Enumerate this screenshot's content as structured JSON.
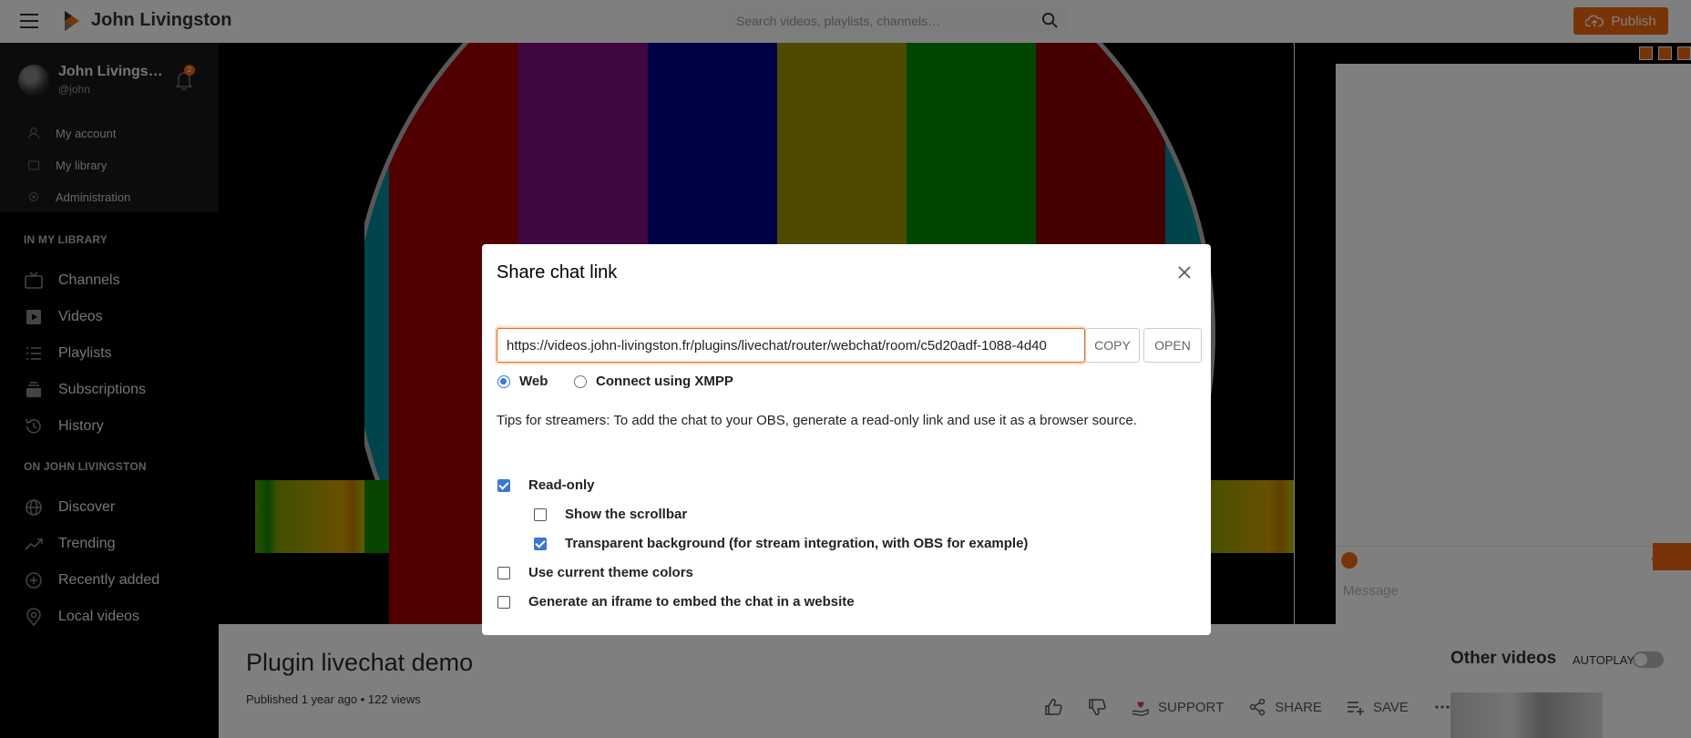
{
  "header": {
    "brand": "John Livingston",
    "search_placeholder": "Search videos, playlists, channels…",
    "publish_label": "Publish"
  },
  "sidebar": {
    "user": {
      "name": "John Livings…",
      "handle": "@john",
      "notifications": "2"
    },
    "user_links": [
      "My account",
      "My library",
      "Administration"
    ],
    "library_title": "IN MY LIBRARY",
    "library_items": [
      "Channels",
      "Videos",
      "Playlists",
      "Subscriptions",
      "History"
    ],
    "instance_title": "ON JOHN LIVINGSTON",
    "instance_items": [
      "Discover",
      "Trending",
      "Recently added",
      "Local videos"
    ]
  },
  "chat": {
    "placeholder": "Message"
  },
  "video": {
    "title": "Plugin livechat demo",
    "meta": "Published 1 year ago • 122 views",
    "actions": {
      "support": "SUPPORT",
      "share": "SHARE",
      "save": "SAVE"
    },
    "other_videos": "Other videos",
    "autoplay": "AUTOPLAY"
  },
  "modal": {
    "title": "Share chat link",
    "url": "https://videos.john-livingston.fr/plugins/livechat/router/webchat/room/c5d20adf-1088-4d40",
    "copy": "COPY",
    "open": "OPEN",
    "radio_web": "Web",
    "radio_xmpp": "Connect using XMPP",
    "tips": "Tips for streamers: To add the chat to your OBS, generate a read-only link and use it as a browser source.",
    "options": {
      "readonly": "Read-only",
      "scrollbar": "Show the scrollbar",
      "transparent": "Transparent background (for stream integration, with OBS for example)",
      "theme": "Use current theme colors",
      "iframe": "Generate an iframe to embed the chat in a website"
    }
  },
  "colors": {
    "accent": "#f1680d",
    "checkbox": "#3b76d6"
  }
}
